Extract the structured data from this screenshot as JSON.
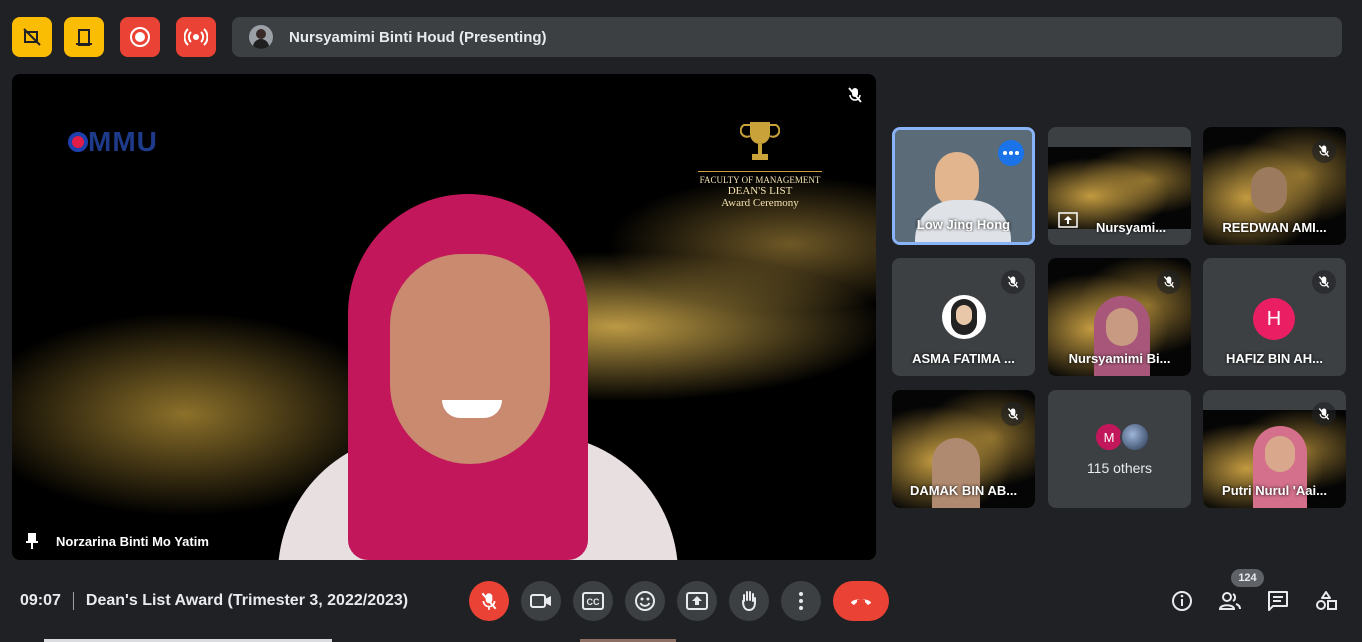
{
  "meeting": {
    "time": "09:07",
    "title": "Dean's List Award (Trimester 3, 2022/2023)",
    "participant_count": "124"
  },
  "presenting": {
    "label": "Nursyamimi Binti Houd (Presenting)"
  },
  "main_tile": {
    "name": "Norzarina Binti Mo Yatim",
    "logo_text": "MMU",
    "slide_lines": [
      "FACULTY OF MANAGEMENT",
      "DEAN'S LIST",
      "Award Ceremony"
    ]
  },
  "tiles": [
    {
      "name": "Low Jing Hong"
    },
    {
      "name": "Nursyami..."
    },
    {
      "name": "REEDWAN AMI..."
    },
    {
      "name": "ASMA FATIMA ..."
    },
    {
      "name": "Nursyamimi Bi..."
    },
    {
      "name": "HAFIZ BIN AH...",
      "initial": "H"
    },
    {
      "name": "DAMAK BIN AB..."
    },
    {
      "name": "115 others",
      "initial": "M"
    },
    {
      "name": "Putri Nurul 'Aai..."
    }
  ],
  "colors": {
    "yellow": "#fbbc04",
    "red": "#ea4335",
    "blue": "#8ab4f8",
    "pink": "#e91e63"
  },
  "icons": {
    "top": [
      "no-video-icon",
      "door-icon",
      "record-icon",
      "broadcast-icon"
    ],
    "controls": [
      "mic-off-icon",
      "camera-icon",
      "captions-icon",
      "emoji-icon",
      "present-icon",
      "raise-hand-icon",
      "more-icon",
      "hang-up-icon"
    ],
    "right": [
      "info-icon",
      "people-icon",
      "chat-icon",
      "activities-icon"
    ]
  }
}
